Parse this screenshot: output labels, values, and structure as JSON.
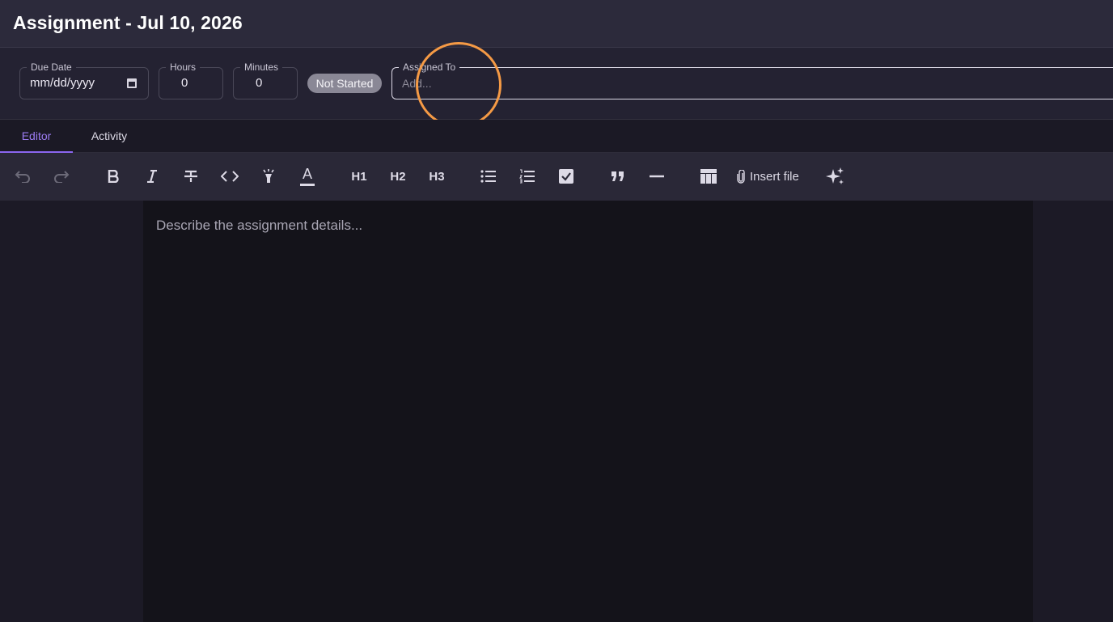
{
  "header": {
    "title": "Assignment - Jul 10, 2026"
  },
  "fields": {
    "due_date": {
      "label": "Due Date",
      "value": "mm/dd/yyyy"
    },
    "hours": {
      "label": "Hours",
      "value": "0"
    },
    "minutes": {
      "label": "Minutes",
      "value": "0"
    },
    "status": "Not Started",
    "assigned_to": {
      "label": "Assigned To",
      "placeholder": "Add..."
    }
  },
  "tabs": [
    {
      "label": "Editor",
      "active": true
    },
    {
      "label": "Activity",
      "active": false
    }
  ],
  "toolbar": {
    "icons": [
      "undo-icon",
      "redo-icon",
      "bold-icon",
      "italic-icon",
      "strikethrough-icon",
      "code-icon",
      "highlight-icon",
      "text-color-icon",
      "bullet-list-icon",
      "numbered-list-icon",
      "checklist-icon",
      "quote-icon",
      "horizontal-rule-icon",
      "table-icon",
      "paperclip-icon",
      "sparkle-icon"
    ],
    "h1": "H1",
    "h2": "H2",
    "h3": "H3",
    "text_color_glyph": "A",
    "insert_file_label": "Insert file"
  },
  "editor": {
    "placeholder": "Describe the assignment details..."
  },
  "colors": {
    "accent": "#8b66f0",
    "cursor_ring": "#f59a45",
    "badge_bg": "#8a8896"
  }
}
